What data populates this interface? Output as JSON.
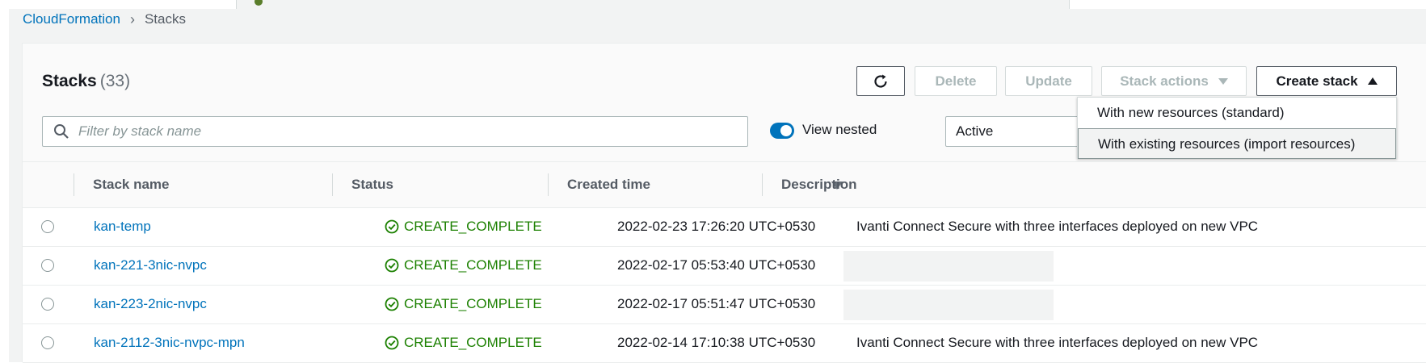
{
  "breadcrumb": {
    "root": "CloudFormation",
    "current": "Stacks"
  },
  "header": {
    "title": "Stacks",
    "count": "(33)"
  },
  "toolbar": {
    "refresh_icon": "refresh-icon",
    "delete_label": "Delete",
    "update_label": "Update",
    "stack_actions_label": "Stack actions",
    "create_stack_label": "Create stack"
  },
  "create_menu": {
    "items": [
      {
        "label": "With new resources (standard)"
      },
      {
        "label": "With existing resources (import resources)"
      }
    ]
  },
  "filter": {
    "placeholder": "Filter by stack name",
    "view_nested_label": "View nested",
    "view_nested_on": true,
    "status_filter": "Active"
  },
  "table": {
    "columns": [
      "Stack name",
      "Status",
      "Created time",
      "Description"
    ],
    "rows": [
      {
        "name": "kan-temp",
        "status": "CREATE_COMPLETE",
        "created": "2022-02-23 17:26:20 UTC+0530",
        "description": "Ivanti Connect Secure with three interfaces deployed on new VPC"
      },
      {
        "name": "kan-221-3nic-nvpc",
        "status": "CREATE_COMPLETE",
        "created": "2022-02-17 05:53:40 UTC+0530",
        "description": ""
      },
      {
        "name": "kan-223-2nic-nvpc",
        "status": "CREATE_COMPLETE",
        "created": "2022-02-17 05:51:47 UTC+0530",
        "description": ""
      },
      {
        "name": "kan-2112-3nic-nvpc-mpn",
        "status": "CREATE_COMPLETE",
        "created": "2022-02-14 17:10:38 UTC+0530",
        "description": "Ivanti Connect Secure with three interfaces deployed on new VPC"
      }
    ]
  },
  "colors": {
    "link": "#0073bb",
    "success": "#1d8102",
    "toggle_on": "#0073bb"
  }
}
